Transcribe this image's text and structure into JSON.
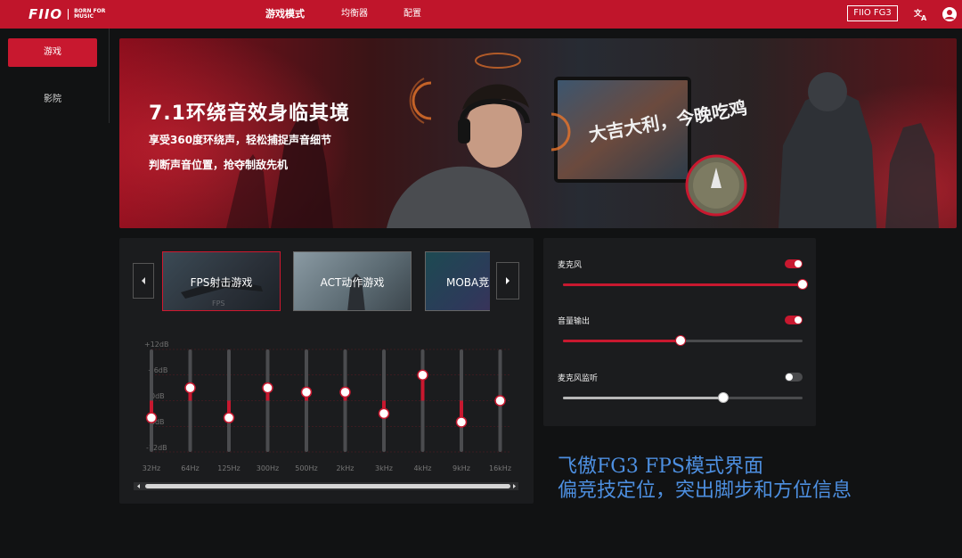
{
  "header": {
    "logo_text": "FIIO",
    "logo_tagline": "BORN FOR MUSIC",
    "nav": [
      {
        "label": "游戏模式",
        "active": true
      },
      {
        "label": "均衡器",
        "active": false
      },
      {
        "label": "配置",
        "active": false
      }
    ],
    "device_button": "FIIO FG3",
    "icons": [
      "translate-icon",
      "user-icon"
    ]
  },
  "sidebar": {
    "items": [
      {
        "label": "游戏",
        "active": true
      },
      {
        "label": "影院",
        "active": false
      }
    ]
  },
  "banner": {
    "title": "7.1环绕音效身临其境",
    "line1": "享受360度环绕声，轻松捕捉声音细节",
    "line2": "判断声音位置，抢夺制敌先机",
    "screen_text": "大吉大利，今晚吃鸡"
  },
  "presets": [
    {
      "label": "FPS射击游戏",
      "active": true
    },
    {
      "label": "ACT动作游戏",
      "active": false
    },
    {
      "label": "MOBA竞",
      "active": false
    }
  ],
  "eq": {
    "db_labels": [
      "+12dB",
      "+6dB",
      "0dB",
      "-6dB",
      "-12dB"
    ],
    "bands": [
      {
        "freq": "32Hz",
        "gain": -4
      },
      {
        "freq": "64Hz",
        "gain": 3
      },
      {
        "freq": "125Hz",
        "gain": -4
      },
      {
        "freq": "300Hz",
        "gain": 3
      },
      {
        "freq": "500Hz",
        "gain": 2
      },
      {
        "freq": "2kHz",
        "gain": 2
      },
      {
        "freq": "3kHz",
        "gain": -3
      },
      {
        "freq": "4kHz",
        "gain": 6
      },
      {
        "freq": "9kHz",
        "gain": -5
      },
      {
        "freq": "16kHz",
        "gain": 0
      }
    ]
  },
  "mic": {
    "controls": [
      {
        "label": "麦克风",
        "enabled": true,
        "level": 1.0
      },
      {
        "label": "音量输出",
        "enabled": true,
        "level": 0.49
      },
      {
        "label": "麦克风监听",
        "enabled": false,
        "level": 0.67
      }
    ]
  },
  "caption": {
    "line1": "飞傲FG3 FPS模式界面",
    "line2": "偏竞技定位，突出脚步和方位信息"
  },
  "colors": {
    "accent": "#c8182f",
    "topbar": "#c0152b",
    "caption": "#4d8fe0",
    "background": "#111213",
    "panel": "#1b1c1e"
  }
}
